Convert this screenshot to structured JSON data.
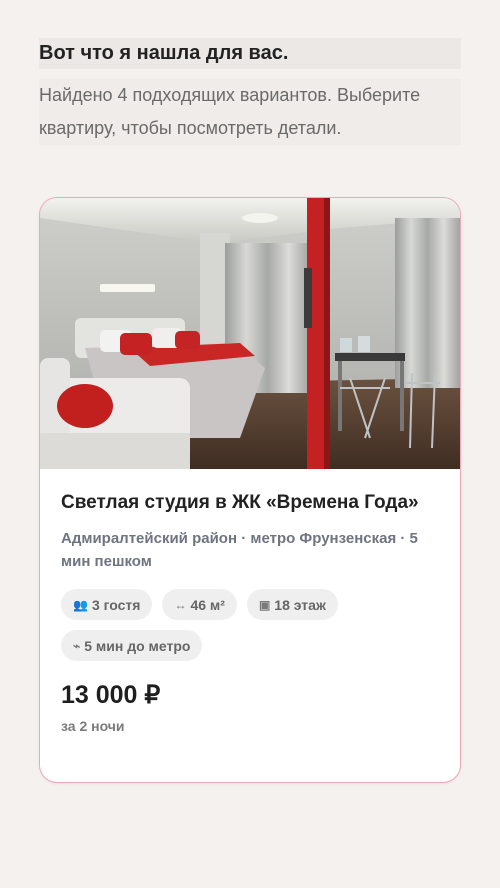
{
  "intro": {
    "title": "Вот что я нашла для вас.",
    "subtitle": "Найдено 4 подходящих вариантов. Выберите квартиру, чтобы посмотреть детали."
  },
  "listing": {
    "title": "Светлая студия в ЖК «Времена Года»",
    "location": "Адмиралтейский район · метро Фрунзенская · 5 мин пешком",
    "features": [
      {
        "icon": "guests-icon",
        "glyph": "👥",
        "label": "3 гостя"
      },
      {
        "icon": "area-icon",
        "glyph": "↔",
        "label": "46 м²"
      },
      {
        "icon": "floor-icon",
        "glyph": "▣",
        "label": "18 этаж"
      },
      {
        "icon": "walk-icon",
        "glyph": "⌁",
        "label": "5 мин до метро"
      }
    ],
    "price": "13 000 ₽",
    "price_note": "за 2 ночи"
  },
  "colors": {
    "page_bg": "#f4f1ef",
    "card_border": "#f0a7b6",
    "accent_red": "#d42a2a"
  }
}
